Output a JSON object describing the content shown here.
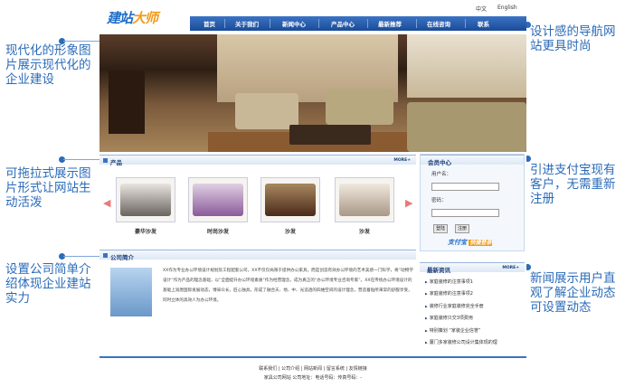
{
  "annotations": {
    "left1": "现代化的形象图片展示现代化的企业建设",
    "left2": "可拖拉式展示图片形式让网站生动活泼",
    "left3": "设置公司简单介绍体现企业建站实力",
    "right1": "设计感的导航网站更具时尚",
    "right2": "引进支付宝现有客户，无需重新注册",
    "right3": "新闻展示用户直观了解企业动态可设置动态"
  },
  "site": {
    "lang_cn": "中文",
    "lang_en": "English",
    "logo_a": "建站",
    "logo_b": "大师",
    "nav": [
      "首页",
      "关于我们",
      "新闻中心",
      "产品中心",
      "最新推荐",
      "在线咨询",
      "联系"
    ],
    "products_title": "产品",
    "more": "MORE+",
    "products": [
      "豪华沙发",
      "时尚沙发",
      "沙发",
      "沙发"
    ],
    "profile_title": "公司简介",
    "profile_text": "XX作为专业办公环境设计规划及工程配套公司，XX不仅仅局限于提供办公家具，而是创造有效办公环境的艺术美感一门科学，将“动物学设计”作为产品的理念基础，以“全面提升办公环境素质”作为经营理念，成为真正的“办公环境专业咨询专家”。XX在传统办公环境设计的基础上润唐国际发展动态，博采众长，匠心独具，形成了融合天、地、中、光造透的四维空间的设计理念，营造着贴所来常的舒服享受，同时立体的高效人为办公环境。",
    "login": {
      "title": "会员中心",
      "user_label": "用户名：",
      "pass_label": "密码：",
      "login_btn": "登陆",
      "register_btn": "注册",
      "alipay_a": "支付宝",
      "alipay_b": "快捷登录"
    },
    "news": {
      "title": "最新资讯",
      "items": [
        "家庭装修的注意事项1",
        "家庭装修的注意事项2",
        "装修行业家庭装修完全手册",
        "家庭装修只交3项费用",
        "特别策划 “家装企业信誉”",
        "厦门多家装修公司设计集体现的理"
      ]
    },
    "footer": {
      "links": "联系我们  |  公司介绍  |  网站新闻  |  留言系统  |  友情链接",
      "info": "家具公司网站  公司地址：电话号码：传真号码：-"
    }
  },
  "colors": {
    "accent": "#2b6bb8",
    "nav": "#1a4b98"
  }
}
